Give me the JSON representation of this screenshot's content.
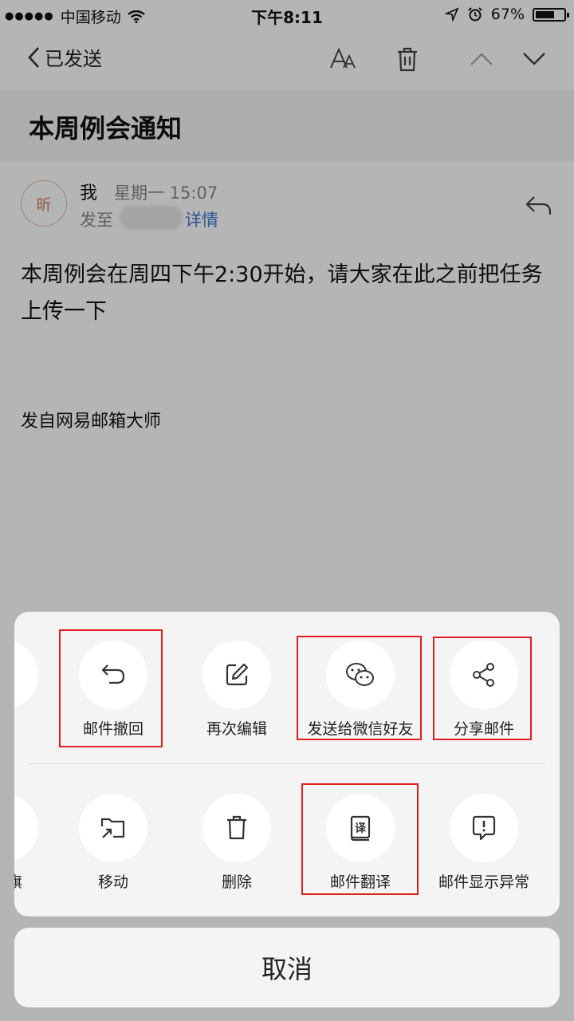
{
  "status_bar": {
    "carrier": "中国移动",
    "time": "下午8:11",
    "battery": "67%",
    "battery_level": 0.67
  },
  "nav": {
    "back_label": "已发送",
    "icons": [
      "font-size-icon",
      "trash-icon",
      "chevron-up-icon",
      "chevron-down-icon"
    ]
  },
  "email": {
    "subject": "本周例会通知",
    "avatar_text": "昕",
    "sender": "我",
    "sent_time": "星期一 15:07",
    "to_label": "发至",
    "details_link": "详情",
    "body": "本周例会在周四下午2:30开始，请大家在此之前把任务上传一下",
    "signature": "发自网易邮箱大师"
  },
  "action_sheet": {
    "row1": [
      {
        "label": "邮件撤回",
        "icon": "undo-icon"
      },
      {
        "label": "再次编辑",
        "icon": "edit-icon"
      },
      {
        "label": "发送给微信好友",
        "icon": "wechat-icon"
      },
      {
        "label": "分享邮件",
        "icon": "share-icon"
      }
    ],
    "row2_partial_label": "旗",
    "row2": [
      {
        "label": "移动",
        "icon": "move-folder-icon"
      },
      {
        "label": "删除",
        "icon": "trash-icon"
      },
      {
        "label": "邮件翻译",
        "icon": "translate-icon"
      },
      {
        "label": "邮件显示异常",
        "icon": "report-icon"
      }
    ],
    "cancel_label": "取消"
  },
  "colors": {
    "link": "#3a7bd5",
    "highlight": "#e02020",
    "sheet_bg": "#f4f4f4"
  }
}
